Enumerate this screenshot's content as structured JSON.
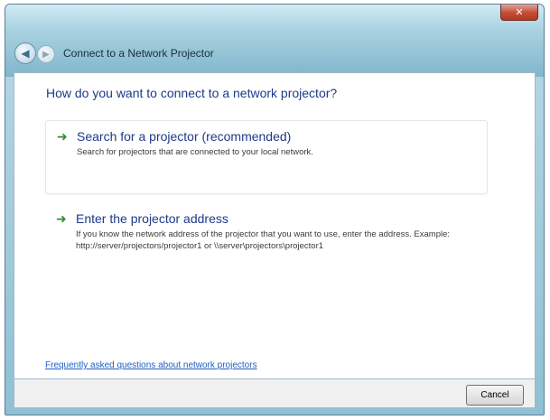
{
  "window": {
    "title": "Connect to a Network Projector",
    "close_glyph": "✕",
    "back_icon": "back-arrow-icon",
    "forward_icon": "forward-arrow-icon"
  },
  "main": {
    "question": "How do you want to connect to a network projector?",
    "options": [
      {
        "title": "Search for a projector (recommended)",
        "description": "Search for projectors that are connected to your local network.",
        "icon": "green-arrow-icon"
      },
      {
        "title": "Enter the projector address",
        "description": "If you know the network address of the projector that you want to use, enter the address. Example: http://server/projectors/projector1 or \\\\server\\projectors\\projector1",
        "icon": "green-arrow-icon"
      }
    ],
    "faq_link": "Frequently asked questions about network projectors"
  },
  "footer": {
    "cancel_label": "Cancel"
  },
  "colors": {
    "accent": "#1e3a8a",
    "arrow": "#2e8f2e",
    "link": "#1f5ec9"
  }
}
